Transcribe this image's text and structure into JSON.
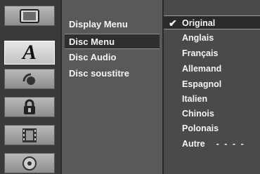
{
  "icons": [
    {
      "name": "tv-icon",
      "active": false
    },
    {
      "name": "language-icon",
      "active": true,
      "glyph": "A"
    },
    {
      "name": "audio-icon",
      "active": false
    },
    {
      "name": "lock-icon",
      "active": false
    },
    {
      "name": "film-icon",
      "active": false
    },
    {
      "name": "disc-icon",
      "active": false
    }
  ],
  "menu": {
    "items": [
      {
        "label": "Display Menu"
      },
      {
        "label": "Disc Menu"
      },
      {
        "label": "Disc Audio"
      },
      {
        "label": "Disc soustitre"
      }
    ],
    "selected": "Disc Menu"
  },
  "options": {
    "items": [
      {
        "label": "Original"
      },
      {
        "label": "Anglais"
      },
      {
        "label": "Français"
      },
      {
        "label": "Allemand"
      },
      {
        "label": "Espagnol"
      },
      {
        "label": "Italien"
      },
      {
        "label": "Chinois"
      },
      {
        "label": "Polonais"
      },
      {
        "label": "Autre"
      }
    ],
    "checked": "Original",
    "check_glyph": "✔",
    "other_code": "- - - -"
  }
}
